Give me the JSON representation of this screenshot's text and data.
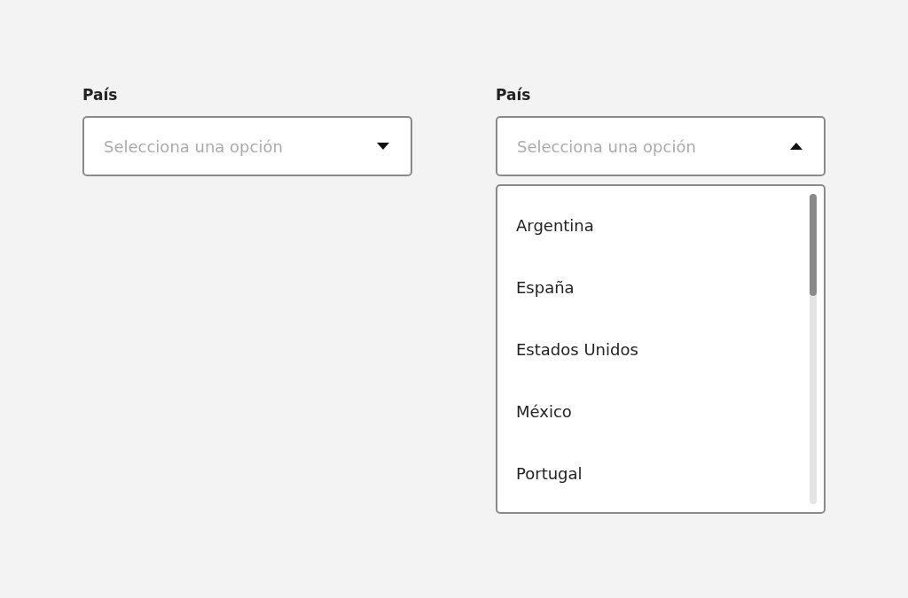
{
  "selects": [
    {
      "label": "País",
      "placeholder": "Selecciona una opción",
      "expanded": false
    },
    {
      "label": "País",
      "placeholder": "Selecciona una opción",
      "expanded": true,
      "options": [
        "Argentina",
        "España",
        "Estados Unidos",
        "México",
        "Portugal"
      ]
    }
  ]
}
